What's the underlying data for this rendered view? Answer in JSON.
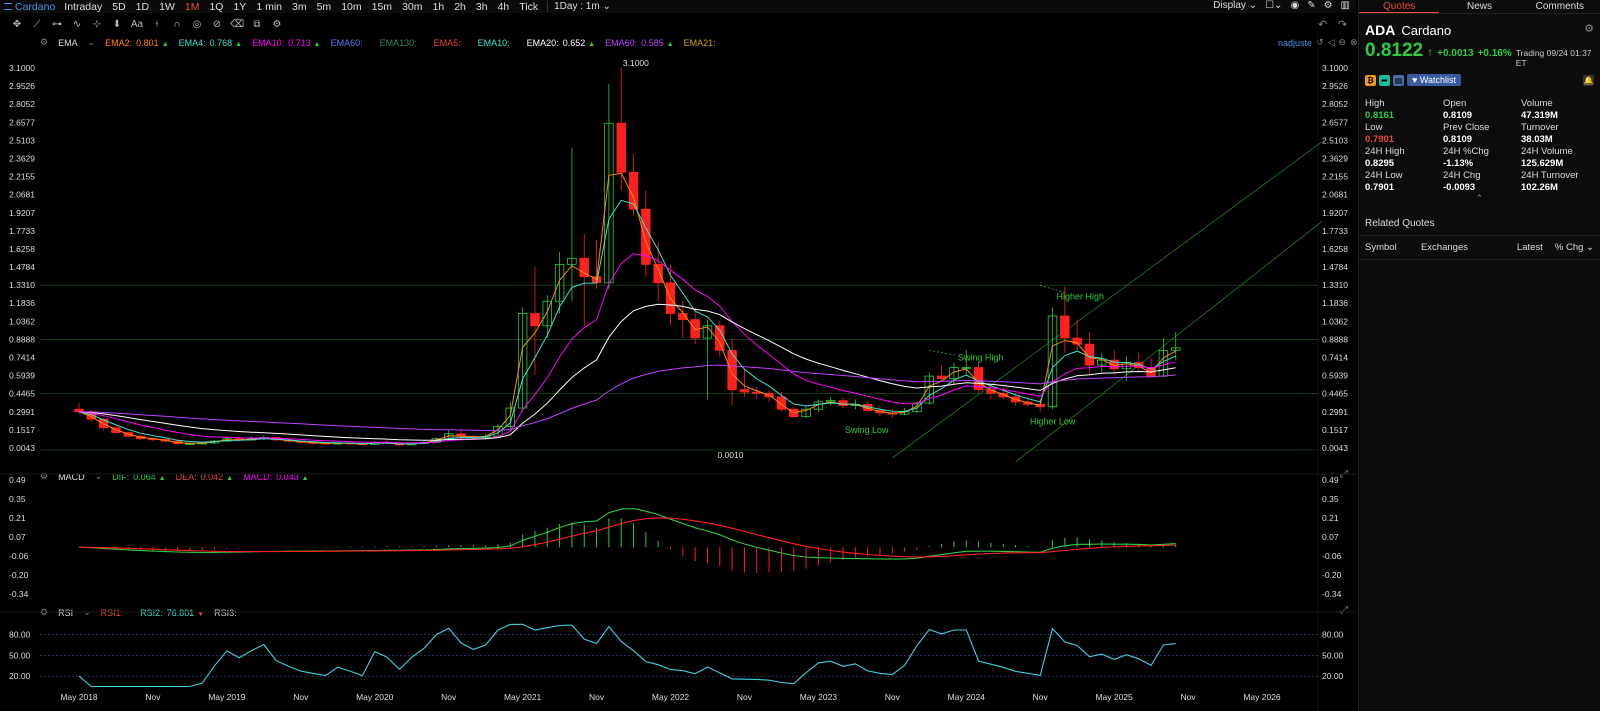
{
  "topbar": {
    "symbol": "Cardano",
    "timeframes": [
      "Intraday",
      "5D",
      "1D",
      "1W",
      "1M",
      "1Q",
      "1Y",
      "1 min",
      "3m",
      "5m",
      "10m",
      "15m",
      "30m",
      "1h",
      "2h",
      "3h",
      "4h",
      "Tick"
    ],
    "active_timeframe": "1M",
    "interval_select": "1Day : 1m",
    "display_label": "Display"
  },
  "ema_legend": {
    "label": "EMA",
    "items": [
      {
        "name": "EMA2:",
        "value": "0.801",
        "color": "#ff8c00",
        "arrow": "▲"
      },
      {
        "name": "EMA4:",
        "value": "0.768",
        "color": "#40e0d0",
        "arrow": "▲"
      },
      {
        "name": "EMA10:",
        "value": "0.713",
        "color": "#ff00ff",
        "arrow": "▲"
      },
      {
        "name": "EMA60:",
        "value": "",
        "color": "#5c7cfa",
        "arrow": ""
      },
      {
        "name": "EMA130:",
        "value": "",
        "color": "#2e8b57",
        "arrow": ""
      },
      {
        "name": "EMA5:",
        "value": "",
        "color": "#e74c3c",
        "arrow": ""
      },
      {
        "name": "EMA10:",
        "value": "",
        "color": "#40e0d0",
        "arrow": ""
      },
      {
        "name": "EMA20:",
        "value": "0.652",
        "color": "#ffffff",
        "arrow": "▲"
      },
      {
        "name": "EMA60:",
        "value": "0.585",
        "color": "#c040ff",
        "arrow": "▲"
      },
      {
        "name": "EMA21:",
        "value": "",
        "color": "#d4a017",
        "arrow": ""
      }
    ],
    "right_text": "nadjuste"
  },
  "macd_legend": {
    "label": "MACD",
    "items": [
      {
        "name": "DIF:",
        "value": "0.064",
        "color": "#2ecc40",
        "arrow": "▲"
      },
      {
        "name": "DEA:",
        "value": "0.042",
        "color": "#e74c3c",
        "arrow": "▲"
      },
      {
        "name": "MACD:",
        "value": "0.043",
        "color": "#ff00ff",
        "arrow": "▲"
      }
    ]
  },
  "rsi_legend": {
    "label": "RSI",
    "items": [
      {
        "name": "RSI1:",
        "value": "",
        "color": "#e74c3c",
        "arrow": ""
      },
      {
        "name": "RSI2:",
        "value": "76.801",
        "color": "#40e0d0",
        "arrow": "▼"
      },
      {
        "name": "RSI3:",
        "value": "",
        "color": "#cccccc",
        "arrow": ""
      }
    ]
  },
  "chart_data": {
    "type": "candlestick",
    "price_ticks": [
      "3.1000",
      "2.9526",
      "2.8052",
      "2.6577",
      "2.5103",
      "2.3629",
      "2.2155",
      "2.0681",
      "1.9207",
      "1.7733",
      "1.6258",
      "1.4784",
      "1.3310",
      "1.1836",
      "1.0362",
      "0.8888",
      "0.7414",
      "0.5939",
      "0.4465",
      "0.2991",
      "0.1517",
      "0.0043"
    ],
    "price_range": [
      0.0043,
      3.1
    ],
    "x_labels": [
      "May 2018",
      "Nov",
      "May 2019",
      "Nov",
      "May 2020",
      "Nov",
      "May 2021",
      "Nov",
      "May 2022",
      "Nov",
      "May 2023",
      "Nov",
      "May 2024",
      "Nov",
      "May 2025",
      "Nov",
      "May 2026"
    ],
    "x_label_months": [
      0,
      6,
      12,
      18,
      24,
      30,
      36,
      42,
      48,
      54,
      60,
      66,
      72,
      78,
      84,
      90,
      96
    ],
    "annotations": {
      "high_price": "3.1000",
      "low_price": "0.0010",
      "swing_high": "Swing High",
      "swing_low": "Swing Low",
      "higher_high": "Higher High",
      "higher_low": "Higher Low"
    },
    "candles": [
      [
        0.32,
        0.37,
        0.28,
        0.3
      ],
      [
        0.3,
        0.31,
        0.22,
        0.24
      ],
      [
        0.24,
        0.25,
        0.15,
        0.17
      ],
      [
        0.17,
        0.18,
        0.12,
        0.13
      ],
      [
        0.13,
        0.14,
        0.09,
        0.1
      ],
      [
        0.1,
        0.11,
        0.07,
        0.08
      ],
      [
        0.08,
        0.09,
        0.06,
        0.075
      ],
      [
        0.075,
        0.08,
        0.05,
        0.06
      ],
      [
        0.06,
        0.065,
        0.03,
        0.04
      ],
      [
        0.04,
        0.048,
        0.032,
        0.04
      ],
      [
        0.04,
        0.05,
        0.035,
        0.045
      ],
      [
        0.045,
        0.07,
        0.04,
        0.06
      ],
      [
        0.06,
        0.09,
        0.055,
        0.08
      ],
      [
        0.08,
        0.09,
        0.06,
        0.07
      ],
      [
        0.07,
        0.1,
        0.065,
        0.08
      ],
      [
        0.08,
        0.11,
        0.07,
        0.09
      ],
      [
        0.09,
        0.1,
        0.06,
        0.07
      ],
      [
        0.07,
        0.08,
        0.05,
        0.06
      ],
      [
        0.06,
        0.065,
        0.04,
        0.05
      ],
      [
        0.05,
        0.06,
        0.04,
        0.045
      ],
      [
        0.045,
        0.05,
        0.035,
        0.04
      ],
      [
        0.04,
        0.05,
        0.035,
        0.045
      ],
      [
        0.045,
        0.05,
        0.035,
        0.04
      ],
      [
        0.04,
        0.05,
        0.03,
        0.033
      ],
      [
        0.033,
        0.06,
        0.032,
        0.05
      ],
      [
        0.05,
        0.07,
        0.04,
        0.045
      ],
      [
        0.045,
        0.05,
        0.02,
        0.03
      ],
      [
        0.03,
        0.05,
        0.025,
        0.04
      ],
      [
        0.04,
        0.06,
        0.035,
        0.05
      ],
      [
        0.05,
        0.09,
        0.045,
        0.08
      ],
      [
        0.08,
        0.15,
        0.07,
        0.12
      ],
      [
        0.12,
        0.16,
        0.08,
        0.1
      ],
      [
        0.1,
        0.11,
        0.08,
        0.09
      ],
      [
        0.09,
        0.12,
        0.08,
        0.1
      ],
      [
        0.1,
        0.2,
        0.09,
        0.18
      ],
      [
        0.18,
        0.38,
        0.15,
        0.33
      ],
      [
        0.33,
        1.15,
        0.3,
        1.1
      ],
      [
        1.1,
        1.48,
        0.6,
        1.0
      ],
      [
        1.0,
        1.25,
        0.9,
        1.2
      ],
      [
        1.2,
        1.6,
        1.1,
        1.5
      ],
      [
        1.5,
        2.45,
        1.2,
        1.55
      ],
      [
        1.55,
        1.75,
        1.0,
        1.4
      ],
      [
        1.4,
        1.7,
        1.3,
        1.35
      ],
      [
        1.35,
        2.97,
        1.3,
        2.65
      ],
      [
        2.65,
        3.1,
        2.1,
        2.25
      ],
      [
        2.25,
        2.4,
        1.9,
        1.95
      ],
      [
        1.95,
        2.1,
        1.4,
        1.5
      ],
      [
        1.5,
        1.68,
        1.2,
        1.35
      ],
      [
        1.35,
        1.5,
        1.0,
        1.1
      ],
      [
        1.1,
        1.2,
        0.9,
        1.05
      ],
      [
        1.05,
        1.15,
        0.85,
        0.9
      ],
      [
        0.9,
        1.05,
        0.4,
        1.0
      ],
      [
        1.0,
        1.04,
        0.75,
        0.8
      ],
      [
        0.8,
        0.9,
        0.35,
        0.48
      ],
      [
        0.48,
        0.65,
        0.42,
        0.46
      ],
      [
        0.46,
        0.5,
        0.4,
        0.45
      ],
      [
        0.45,
        0.48,
        0.38,
        0.42
      ],
      [
        0.42,
        0.46,
        0.3,
        0.32
      ],
      [
        0.32,
        0.34,
        0.25,
        0.26
      ],
      [
        0.26,
        0.35,
        0.25,
        0.32
      ],
      [
        0.32,
        0.4,
        0.3,
        0.38
      ],
      [
        0.38,
        0.42,
        0.35,
        0.39
      ],
      [
        0.39,
        0.42,
        0.33,
        0.35
      ],
      [
        0.35,
        0.4,
        0.32,
        0.36
      ],
      [
        0.36,
        0.38,
        0.3,
        0.31
      ],
      [
        0.31,
        0.34,
        0.26,
        0.29
      ],
      [
        0.29,
        0.32,
        0.25,
        0.28
      ],
      [
        0.28,
        0.33,
        0.27,
        0.3
      ],
      [
        0.3,
        0.38,
        0.29,
        0.37
      ],
      [
        0.37,
        0.62,
        0.36,
        0.59
      ],
      [
        0.59,
        0.68,
        0.55,
        0.57
      ],
      [
        0.57,
        0.7,
        0.52,
        0.66
      ],
      [
        0.66,
        0.8,
        0.6,
        0.66
      ],
      [
        0.66,
        0.7,
        0.45,
        0.48
      ],
      [
        0.48,
        0.52,
        0.4,
        0.45
      ],
      [
        0.45,
        0.5,
        0.4,
        0.42
      ],
      [
        0.42,
        0.45,
        0.35,
        0.38
      ],
      [
        0.38,
        0.42,
        0.34,
        0.36
      ],
      [
        0.36,
        0.4,
        0.3,
        0.34
      ],
      [
        0.34,
        1.15,
        0.32,
        1.08
      ],
      [
        1.08,
        1.32,
        0.78,
        0.9
      ],
      [
        0.9,
        1.05,
        0.8,
        0.85
      ],
      [
        0.85,
        0.95,
        0.6,
        0.68
      ],
      [
        0.68,
        0.78,
        0.62,
        0.72
      ],
      [
        0.72,
        0.8,
        0.6,
        0.65
      ],
      [
        0.65,
        0.75,
        0.55,
        0.7
      ],
      [
        0.7,
        0.78,
        0.62,
        0.66
      ],
      [
        0.66,
        0.74,
        0.58,
        0.59
      ],
      [
        0.59,
        0.9,
        0.58,
        0.8
      ],
      [
        0.8,
        0.95,
        0.72,
        0.82
      ]
    ],
    "ema_lines": [
      {
        "name": "EMA2",
        "color": "#ff8c00",
        "period": 2
      },
      {
        "name": "EMA4",
        "color": "#40e0d0",
        "period": 4
      },
      {
        "name": "EMA10",
        "color": "#ff00ff",
        "period": 10
      },
      {
        "name": "EMA20",
        "color": "#ffffff",
        "period": 20
      },
      {
        "name": "EMA60",
        "color": "#c040ff",
        "period": 60
      }
    ],
    "macd_ticks": [
      "0.49",
      "0.35",
      "0.21",
      "0.07",
      "-0.06",
      "-0.20",
      "-0.34"
    ],
    "macd_range": [
      -0.34,
      0.49
    ],
    "rsi_ticks": [
      "80.00",
      "50.00",
      "20.00"
    ],
    "rsi_range": [
      0,
      100
    ]
  },
  "right_panel": {
    "tabs": [
      "Quotes",
      "News",
      "Comments"
    ],
    "active_tab": "Quotes",
    "symbol_code": "ADA",
    "symbol_name": "Cardano",
    "price": "0.8122",
    "change_arrow": "↑",
    "change": "+0.0013",
    "change_pct": "+0.16%",
    "trading_time": "Trading 09/24 01:37 ET",
    "watchlist_label": "Watchlist",
    "stats": [
      {
        "label": "High",
        "value": "0.8161",
        "color": "green"
      },
      {
        "label": "Open",
        "value": "0.8109",
        "color": ""
      },
      {
        "label": "Volume",
        "value": "47.319M",
        "color": ""
      },
      {
        "label": "Low",
        "value": "0.7901",
        "color": "red"
      },
      {
        "label": "Prev Close",
        "value": "0.8109",
        "color": ""
      },
      {
        "label": "Turnover",
        "value": "38.03M",
        "color": ""
      },
      {
        "label": "24H High",
        "value": "0.8295",
        "color": ""
      },
      {
        "label": "24H %Chg",
        "value": "-1.13%",
        "color": ""
      },
      {
        "label": "24H Volume",
        "value": "125.629M",
        "color": ""
      },
      {
        "label": "24H Low",
        "value": "0.7901",
        "color": ""
      },
      {
        "label": "24H Chg",
        "value": "-0.0093",
        "color": ""
      },
      {
        "label": "24H Turnover",
        "value": "102.26M",
        "color": ""
      }
    ],
    "related_title": "Related Quotes",
    "related_headers": [
      "Symbol",
      "Exchanges",
      "Latest",
      "% Chg"
    ]
  }
}
